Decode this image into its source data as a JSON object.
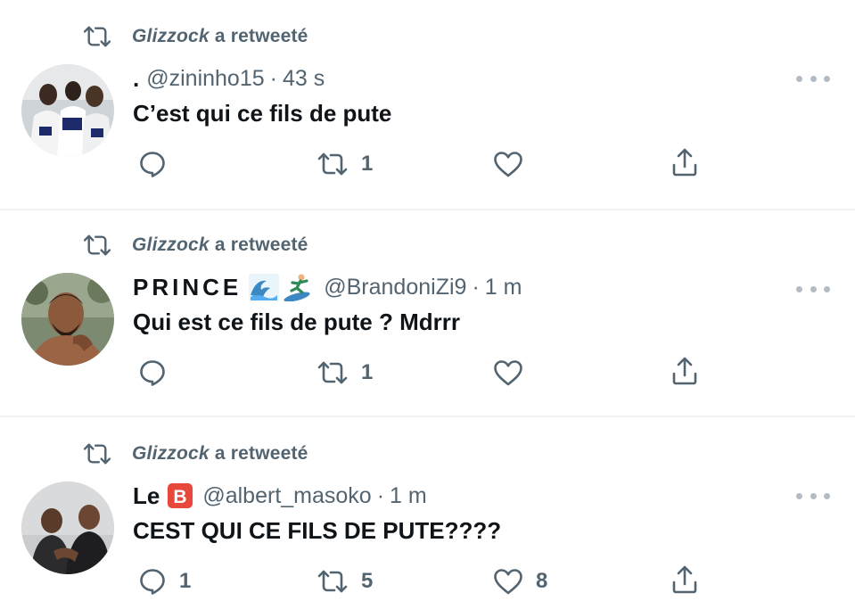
{
  "tweets": [
    {
      "retweet_name": "Glizzock",
      "retweet_suffix": " a retweeté",
      "display_name": ".",
      "handle": "@zininho15",
      "separator": "·",
      "time": "43 s",
      "text": "C’est qui ce fils de pute",
      "reply_count": "",
      "retweet_count": "1",
      "like_count": ""
    },
    {
      "retweet_name": "Glizzock",
      "retweet_suffix": " a retweeté",
      "display_name": "PRINCE",
      "display_emojis": [
        "water-wave-emoji",
        "surfer-emoji"
      ],
      "handle": "@BrandoniZi9",
      "separator": "·",
      "time": "1 m",
      "text": "Qui est ce fils de pute ? Mdrrr",
      "reply_count": "",
      "retweet_count": "1",
      "like_count": ""
    },
    {
      "retweet_name": "Glizzock",
      "retweet_suffix": " a retweeté",
      "display_name": "Le",
      "display_emojis": [
        "b-button-emoji"
      ],
      "handle": "@albert_masoko",
      "separator": "·",
      "time": "1 m",
      "text": "CEST QUI CE FILS DE PUTE????",
      "reply_count": "1",
      "retweet_count": "5",
      "like_count": "8"
    }
  ],
  "colors": {
    "text_primary": "#0f1419",
    "text_secondary": "#536471",
    "divider": "#eff3f4",
    "more_dots": "#b3bcc4",
    "emoji_b_red": "#e8473b"
  },
  "icons": {
    "retweet_header": "retweet-icon",
    "reply": "reply-icon",
    "retweet": "retweet-icon",
    "like": "heart-icon",
    "share": "share-icon",
    "more": "more-icon"
  }
}
